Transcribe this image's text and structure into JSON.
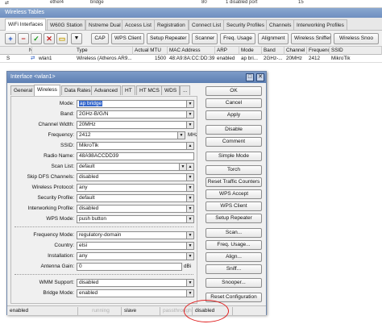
{
  "top_remnant": {
    "c1": "ether4",
    "c2": "bridge",
    "c3": "80",
    "c4": "1 disabled port",
    "c5": "15"
  },
  "window_title": "Wireless Tables",
  "tabs": [
    "WiFi Interfaces",
    "W60G Station",
    "Nstreme Dual",
    "Access List",
    "Registration",
    "Connect List",
    "Security Profiles",
    "Channels",
    "Interworking Profiles"
  ],
  "toolbar": {
    "add": "+",
    "remove": "−",
    "enable": "✓",
    "disable": "✕",
    "comment": "▭",
    "filter": "▼",
    "buttons": [
      "CAP",
      "WPS Client",
      "Setup Repeater",
      "Scanner",
      "Freq. Usage",
      "Alignment",
      "Wireless Sniffer",
      "Wireless Snoo"
    ]
  },
  "table": {
    "headers": [
      "Name",
      "Type",
      "Actual MTU",
      "MAC Address",
      "ARP",
      "Mode",
      "Band",
      "Channel Width",
      "Frequency",
      "SSID"
    ],
    "row": {
      "flag": "S",
      "name": "wlan1",
      "type": "Wireless (Atheros AR9...",
      "mtu": "1500",
      "mac": "48:A9:8A:CC:DD:39",
      "arp": "enabled",
      "mode": "ap bri...",
      "band": "2GHz-...",
      "width": "20MHz",
      "freq": "2412",
      "ssid": "MikroTik"
    }
  },
  "dialog": {
    "title": "Interface <wlan1>",
    "min": "□",
    "close": "✕",
    "tabs": [
      "General",
      "Wireless",
      "Data Rates",
      "Advanced",
      "HT",
      "HT MCS",
      "WDS",
      "..."
    ],
    "fields": {
      "mode": {
        "label": "Mode:",
        "value": "ap bridge"
      },
      "band": {
        "label": "Band:",
        "value": "2GHz-B/G/N"
      },
      "width": {
        "label": "Channel Width:",
        "value": "20MHz"
      },
      "freq": {
        "label": "Frequency:",
        "value": "2412",
        "unit": "MHz"
      },
      "ssid": {
        "label": "SSID:",
        "value": "MikroTik"
      },
      "radio": {
        "label": "Radio Name:",
        "value": "48A98ACCDD39"
      },
      "scan": {
        "label": "Scan List:",
        "value": "default"
      },
      "dfs": {
        "label": "Skip DFS Channels:",
        "value": "disabled"
      },
      "proto": {
        "label": "Wireless Protocol:",
        "value": "any"
      },
      "sec": {
        "label": "Security Profile:",
        "value": "default"
      },
      "interworking": {
        "label": "Interworking Profile:",
        "value": "disabled"
      },
      "wps": {
        "label": "WPS Mode:",
        "value": "push button"
      },
      "freqmode": {
        "label": "Frequency Mode:",
        "value": "regulatory-domain"
      },
      "country": {
        "label": "Country:",
        "value": "etsi"
      },
      "install": {
        "label": "Installation:",
        "value": "any"
      },
      "gain": {
        "label": "Antenna Gain:",
        "value": "0",
        "unit": "dBi"
      },
      "wmm": {
        "label": "WMM Support:",
        "value": "disabled"
      },
      "bridgemode": {
        "label": "Bridge Mode:",
        "value": "enabled"
      }
    },
    "buttons": [
      "OK",
      "Cancel",
      "Apply",
      "Disable",
      "Comment",
      "Simple Mode",
      "Torch",
      "Reset Traffic Counters",
      "WPS Accept",
      "WPS Client",
      "Setup Repeater",
      "Scan...",
      "Freq. Usage...",
      "Align...",
      "Sniff...",
      "Snooper...",
      "Reset Configuration"
    ],
    "status": {
      "s1": "enabled",
      "s2": "running",
      "s3": "slave",
      "s4": "passthrough",
      "s5": "disabled"
    }
  },
  "colors": {
    "title_bar": "#5d7fb3",
    "selection": "#3366cc",
    "highlight_circle": "#e02020"
  }
}
